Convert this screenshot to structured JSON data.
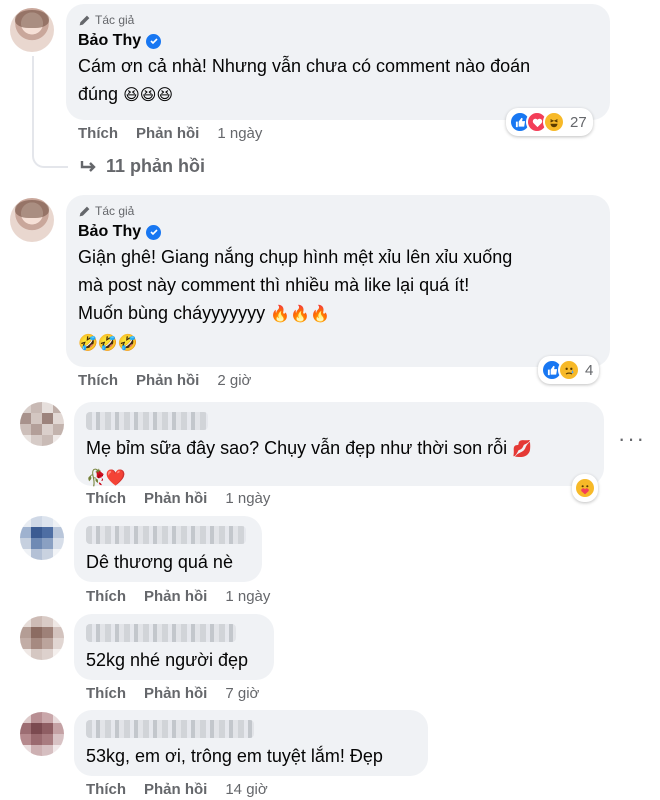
{
  "comments": [
    {
      "author_badge": "Tác giả",
      "name": "Bảo Thy",
      "text_line1": "Cám ơn cả nhà! Nhưng vẫn chưa có comment nào đoán",
      "text_line2": "đúng",
      "emoji": "😆😆😆",
      "like_label": "Thích",
      "reply_label": "Phản hồi",
      "time": "1 ngày",
      "reaction_count": "27",
      "replies_label": "11 phản hồi"
    },
    {
      "author_badge": "Tác giả",
      "name": "Bảo Thy",
      "text_line1": "Giận ghê! Giang nắng chụp hình mệt xỉu lên xỉu xuống",
      "text_line2": "mà post này comment thì nhiều mà like lại quá ít!",
      "text_line3": "Muốn bùng cháyyyyyyy",
      "fire": "🔥🔥🔥",
      "laugh": "🤣🤣🤣",
      "like_label": "Thích",
      "reply_label": "Phản hồi",
      "time": "2 giờ",
      "reaction_count": "4"
    },
    {
      "text": "Mẹ bỉm sữa đây sao? Chụy vẫn đẹp như thời son rỗi",
      "emoji_end": "💋",
      "emoji_line2": "🥀❤️",
      "like_label": "Thích",
      "reply_label": "Phản hồi",
      "time": "1 ngày",
      "more": "···"
    },
    {
      "text": "Dê thương quá nè",
      "like_label": "Thích",
      "reply_label": "Phản hồi",
      "time": "1 ngày"
    },
    {
      "text": "52kg nhé người đẹp",
      "like_label": "Thích",
      "reply_label": "Phản hồi",
      "time": "7 giờ"
    },
    {
      "text": "53kg, em ơi, trông em tuyệt lắm! Đẹp",
      "like_label": "Thích",
      "reply_label": "Phản hồi",
      "time": "14 giờ"
    }
  ],
  "colors": {
    "bubble": "#f0f2f5",
    "secondary_text": "#65676b",
    "verified": "#1877f2"
  }
}
